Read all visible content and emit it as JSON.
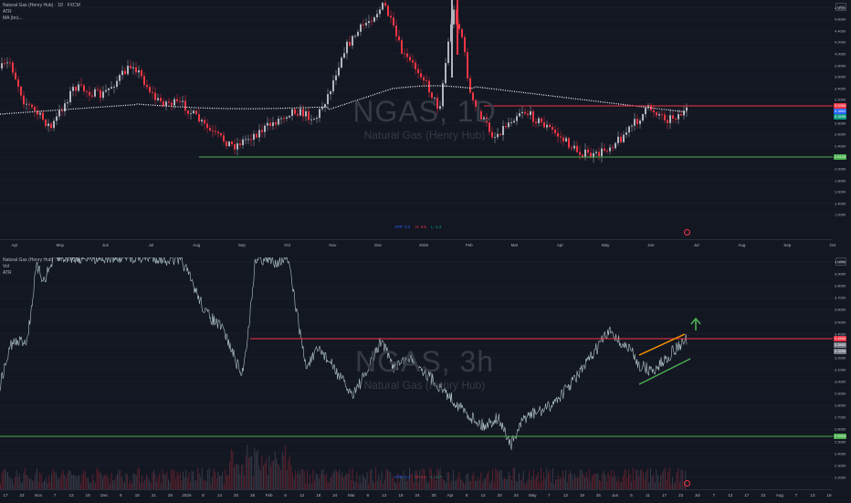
{
  "top_pane": {
    "legend": [
      "Natural Gas (Henry Hub) · 1D · FXCM",
      "ATR",
      "MA (bn)..."
    ],
    "watermark_symbol": "NGAS, 1D",
    "watermark_name": "Natural Gas (Henry Hub)",
    "currency": "USD",
    "price_ticks": [
      "4.8000",
      "4.6000",
      "4.4000",
      "4.2000",
      "4.0000",
      "3.8000",
      "3.6000",
      "3.4000",
      "3.2000",
      "3.0000",
      "2.8000",
      "2.6000",
      "2.4000",
      "2.2000",
      "2.0000",
      "1.8000",
      "1.6000",
      "1.4000",
      "1.2000"
    ],
    "x_ticks": [
      "Apr",
      "May",
      "Jun",
      "Jul",
      "Aug",
      "Sep",
      "Oct",
      "Nov",
      "Dec",
      "2026",
      "Feb",
      "Mar",
      "Apr",
      "May",
      "Jun",
      "Jul",
      "Aug",
      "Sep",
      "Oct"
    ],
    "price_tags": [
      {
        "label": "3.5350",
        "color": "#f23645"
      },
      {
        "label": "3.3892",
        "color": "#2962ff"
      },
      {
        "label": "3.3290",
        "color": "#089981"
      },
      {
        "label": "2.6120",
        "color": "#4caf50"
      }
    ],
    "indicator": {
      "a": "ATR: 0.2",
      "b": "H: 3.6",
      "c": "L: 3.3"
    }
  },
  "bottom_pane": {
    "legend": [
      "Natural Gas (Henry Hub) · 3h · FXCM",
      "Vol",
      "ATR"
    ],
    "watermark_symbol": "NGAS, 3h",
    "watermark_name": "Natural Gas (Henry Hub)",
    "currency": "USD",
    "price_ticks": [
      "4.0000",
      "3.9000",
      "3.8000",
      "3.7000",
      "3.6000",
      "3.5000",
      "3.4000",
      "3.3000",
      "3.2000",
      "3.1000",
      "3.0000",
      "2.9000",
      "2.8000",
      "2.7000",
      "2.6000",
      "2.5000",
      "2.4000",
      "2.3000",
      "2.2000"
    ],
    "x_ticks": [
      "17",
      "23",
      "Nov",
      "7",
      "13",
      "19",
      "Dec",
      "9",
      "15",
      "21",
      "29",
      "2026",
      "8",
      "14",
      "20",
      "26",
      "Feb",
      "6",
      "12",
      "18",
      "24",
      "Mar",
      "6",
      "12",
      "18",
      "24",
      "30",
      "Apr",
      "8",
      "14",
      "20",
      "24",
      "May",
      "7",
      "13",
      "19",
      "25",
      "Jun",
      "5",
      "11",
      "17",
      "23",
      "Jul",
      "7",
      "13",
      "17",
      "23",
      "Aug",
      "7",
      "13",
      "19"
    ],
    "price_tags": [
      {
        "label": "3.4550",
        "color": "#f23645"
      },
      {
        "label": "3.3892",
        "color": "#787b86"
      },
      {
        "label": "3.3290",
        "color": "#787b86"
      },
      {
        "label": "2.5310",
        "color": "#4caf50"
      }
    ],
    "indicator": {
      "a": "ATR: 0.1",
      "b": "H: 0.4",
      "c": "L: 2.7"
    }
  },
  "colors": {
    "background": "#131722",
    "up": "#b2b5be",
    "down": "#f23645",
    "resistance": "#f23645",
    "support": "#4caf50",
    "channel_top": "#ff9800",
    "channel_bottom": "#4caf50",
    "arrow": "#4caf50",
    "ma": "#ffffff"
  }
}
